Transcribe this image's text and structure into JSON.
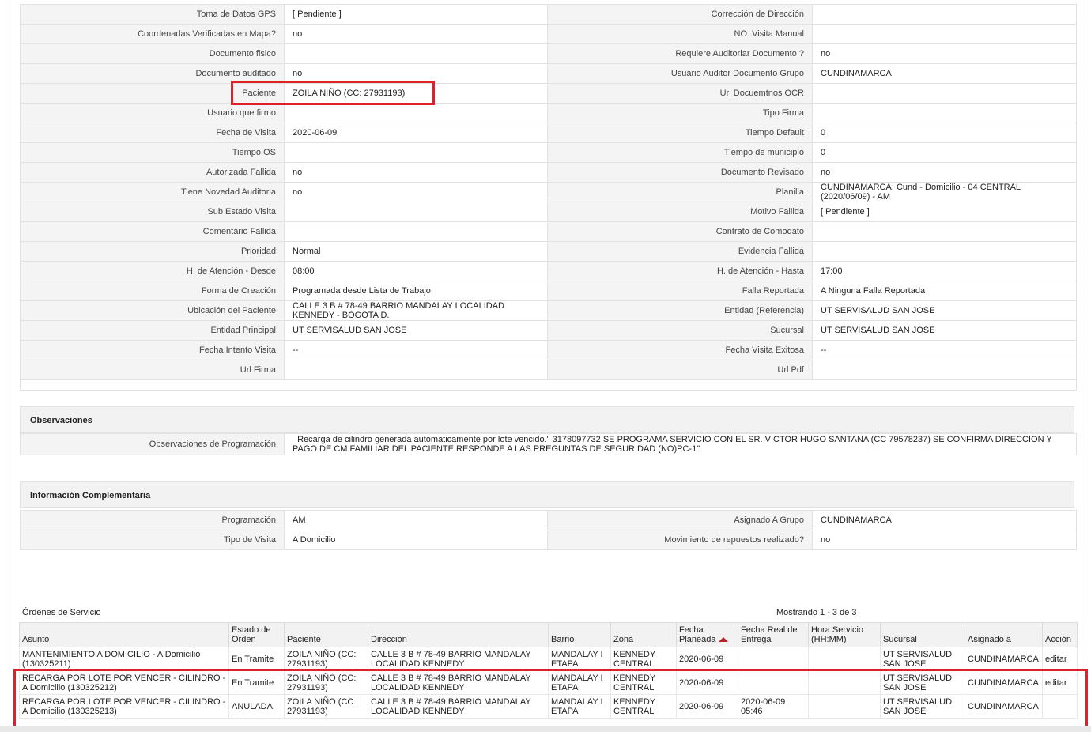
{
  "details": [
    {
      "l1": "Toma de Datos GPS",
      "v1": "[ Pendiente ]",
      "l2": "Corrección de Dirección",
      "v2": ""
    },
    {
      "l1": "Coordenadas Verificadas en Mapa?",
      "v1": " no",
      "l2": "NO. Visita Manual",
      "v2": ""
    },
    {
      "l1": "Documento fisico",
      "v1": "",
      "l2": "Requiere Auditoriar Documento ?",
      "v2": " no"
    },
    {
      "l1": "Documento auditado",
      "v1": " no",
      "l2": "Usuario Auditor Documento Grupo",
      "v2": "CUNDINAMARCA"
    },
    {
      "l1": "Paciente",
      "v1": "ZOILA NIÑO (CC: 27931193)",
      "l2": "Url Docuemtnos OCR",
      "v2": ""
    },
    {
      "l1": "Usuario que firmo",
      "v1": "",
      "l2": "Tipo Firma",
      "v2": ""
    },
    {
      "l1": "Fecha de Visita",
      "v1": " 2020-06-09",
      "l2": "Tiempo Default",
      "v2": "0"
    },
    {
      "l1": "Tiempo OS",
      "v1": "",
      "l2": "Tiempo de municipio",
      "v2": "0"
    },
    {
      "l1": "Autorizada Fallida",
      "v1": " no",
      "l2": "Documento Revisado",
      "v2": " no"
    },
    {
      "l1": "Tiene Novedad Auditoria",
      "v1": " no",
      "l2": "Planilla",
      "v2": "CUNDINAMARCA: Cund - Domicilio - 04 CENTRAL (2020/06/09) - AM"
    },
    {
      "l1": "Sub Estado Visita",
      "v1": "",
      "l2": "Motivo Fallida",
      "v2": "[ Pendiente ]"
    },
    {
      "l1": "Comentario Fallida",
      "v1": "",
      "l2": "Contrato de Comodato",
      "v2": ""
    },
    {
      "l1": "Prioridad",
      "v1": "Normal",
      "l2": "Evidencia Fallida",
      "v2": ""
    },
    {
      "l1": "H. de Atención - Desde",
      "v1": "08:00",
      "l2": "H. de Atención - Hasta",
      "v2": " 17:00"
    },
    {
      "l1": "Forma de Creación",
      "v1": "Programada desde Lista de Trabajo",
      "l2": "Falla Reportada",
      "v2": "A Ninguna Falla Reportada"
    },
    {
      "l1": "Ubicación del Paciente",
      "v1": "CALLE 3 B # 78-49 BARRIO MANDALAY LOCALIDAD KENNEDY - BOGOTA D.",
      "l2": "Entidad (Referencia)",
      "v2": "UT SERVISALUD SAN JOSE"
    },
    {
      "l1": "Entidad Principal",
      "v1": "UT SERVISALUD SAN JOSE",
      "l2": "Sucursal",
      "v2": "UT SERVISALUD SAN JOSE"
    },
    {
      "l1": "Fecha Intento Visita",
      "v1": " --",
      "l2": "Fecha Visita Exitosa",
      "v2": " --"
    },
    {
      "l1": "Url Firma",
      "v1": "",
      "l2": "Url Pdf",
      "v2": ""
    }
  ],
  "observaciones": {
    "title": "Observaciones",
    "label": "Observaciones de Programación",
    "value": "  Recarga de cilindro generada automaticamente por lote vencido.\" 3178097732 SE PROGRAMA SERVICIO CON EL SR. VICTOR HUGO SANTANA (CC 79578237) SE CONFIRMA DIRECCION Y PAGO DE CM FAMILIAR DEL PACIENTE RESPONDE A LAS PREGUNTAS DE SEGURIDAD (NO)PC-1\""
  },
  "complementaria": {
    "title": "Información Complementaria",
    "rows": [
      {
        "l1": "Programación",
        "v1": "AM",
        "l2": "Asignado A Grupo",
        "v2": "CUNDINAMARCA"
      },
      {
        "l1": "Tipo de Visita",
        "v1": "A Domicilio",
        "l2": "Movimiento de repuestos realizado?",
        "v2": " no"
      }
    ]
  },
  "orders": {
    "title": "Órdenes de Servicio",
    "count": "Mostrando 1 - 3 de 3",
    "headers": [
      "Asunto",
      "Estado de Orden",
      "Paciente",
      "Direccion",
      "Barrio",
      "Zona",
      "Fecha Planeada",
      "Fecha Real de Entrega",
      "Hora Servicio (HH:MM)",
      "Sucursal",
      "Asignado a",
      "Acción"
    ],
    "rows": [
      [
        "MANTENIMIENTO A DOMICILIO - A Domicilio (130325211)",
        "En Tramite",
        "ZOILA NIÑO (CC: 27931193)",
        "CALLE 3 B # 78-49 BARRIO MANDALAY LOCALIDAD KENNEDY",
        "MANDALAY I ETAPA",
        "KENNEDY CENTRAL",
        "2020-06-09",
        "",
        "",
        "UT SERVISALUD SAN JOSE",
        "CUNDINAMARCA",
        "editar"
      ],
      [
        "RECARGA POR LOTE POR VENCER - CILINDRO - A Domicilio (130325212)",
        "En Tramite",
        "ZOILA NIÑO (CC: 27931193)",
        "CALLE 3 B # 78-49 BARRIO MANDALAY LOCALIDAD KENNEDY",
        "MANDALAY I ETAPA",
        "KENNEDY CENTRAL",
        "2020-06-09",
        "",
        "",
        "UT SERVISALUD SAN JOSE",
        "CUNDINAMARCA",
        "editar"
      ],
      [
        "RECARGA POR LOTE POR VENCER - CILINDRO - A Domicilio (130325213)",
        "ANULADA",
        "ZOILA NIÑO (CC: 27931193)",
        "CALLE 3 B # 78-49 BARRIO MANDALAY LOCALIDAD KENNEDY",
        "MANDALAY I ETAPA",
        "KENNEDY CENTRAL",
        "2020-06-09",
        "2020-06-09 05:46",
        "",
        "UT SERVISALUD SAN JOSE",
        "CUNDINAMARCA",
        ""
      ]
    ]
  },
  "colors": {
    "highlight": "#e0212c",
    "sort_arrow": "#b32025"
  }
}
